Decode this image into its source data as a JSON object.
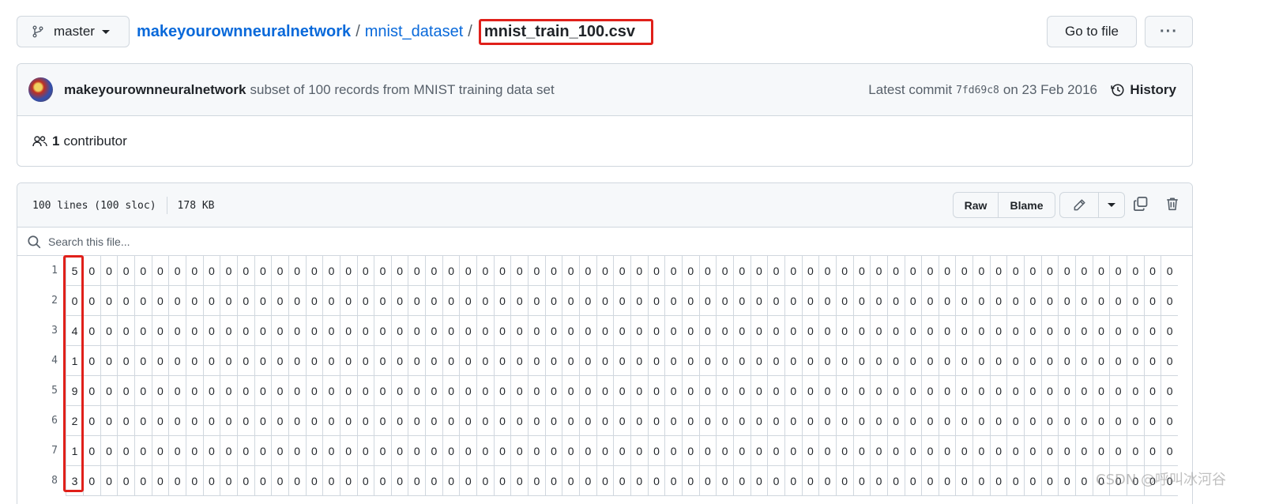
{
  "branch": {
    "label": "master"
  },
  "breadcrumb": {
    "repo": "makeyourownneuralnetwork",
    "dir": "mnist_dataset",
    "file": "mnist_train_100.csv",
    "sep": "/"
  },
  "toolbar": {
    "goto_label": "Go to file",
    "more_label": "···"
  },
  "commit": {
    "author": "makeyourownneuralnetwork",
    "message": "subset of 100 records from MNIST training data set",
    "latest_label": "Latest commit",
    "sha": "7fd69c8",
    "date_text": "on 23 Feb 2016",
    "history_label": "History"
  },
  "contributors": {
    "count": "1",
    "label": "contributor"
  },
  "file": {
    "lines": "100 lines (100 sloc)",
    "size": "178 KB",
    "raw_label": "Raw",
    "blame_label": "Blame"
  },
  "search": {
    "placeholder": "Search this file..."
  },
  "rows": [
    {
      "line": "1",
      "label": "5"
    },
    {
      "line": "2",
      "label": "0"
    },
    {
      "line": "3",
      "label": "4"
    },
    {
      "line": "4",
      "label": "1"
    },
    {
      "line": "5",
      "label": "9"
    },
    {
      "line": "6",
      "label": "2"
    },
    {
      "line": "7",
      "label": "1"
    },
    {
      "line": "8",
      "label": "3"
    }
  ],
  "pixel_value": "0",
  "watermark": "CSDN @呼叫冰河谷",
  "colors": {
    "link": "#0969da",
    "highlight": "#e0201a",
    "border": "#d0d7de"
  }
}
